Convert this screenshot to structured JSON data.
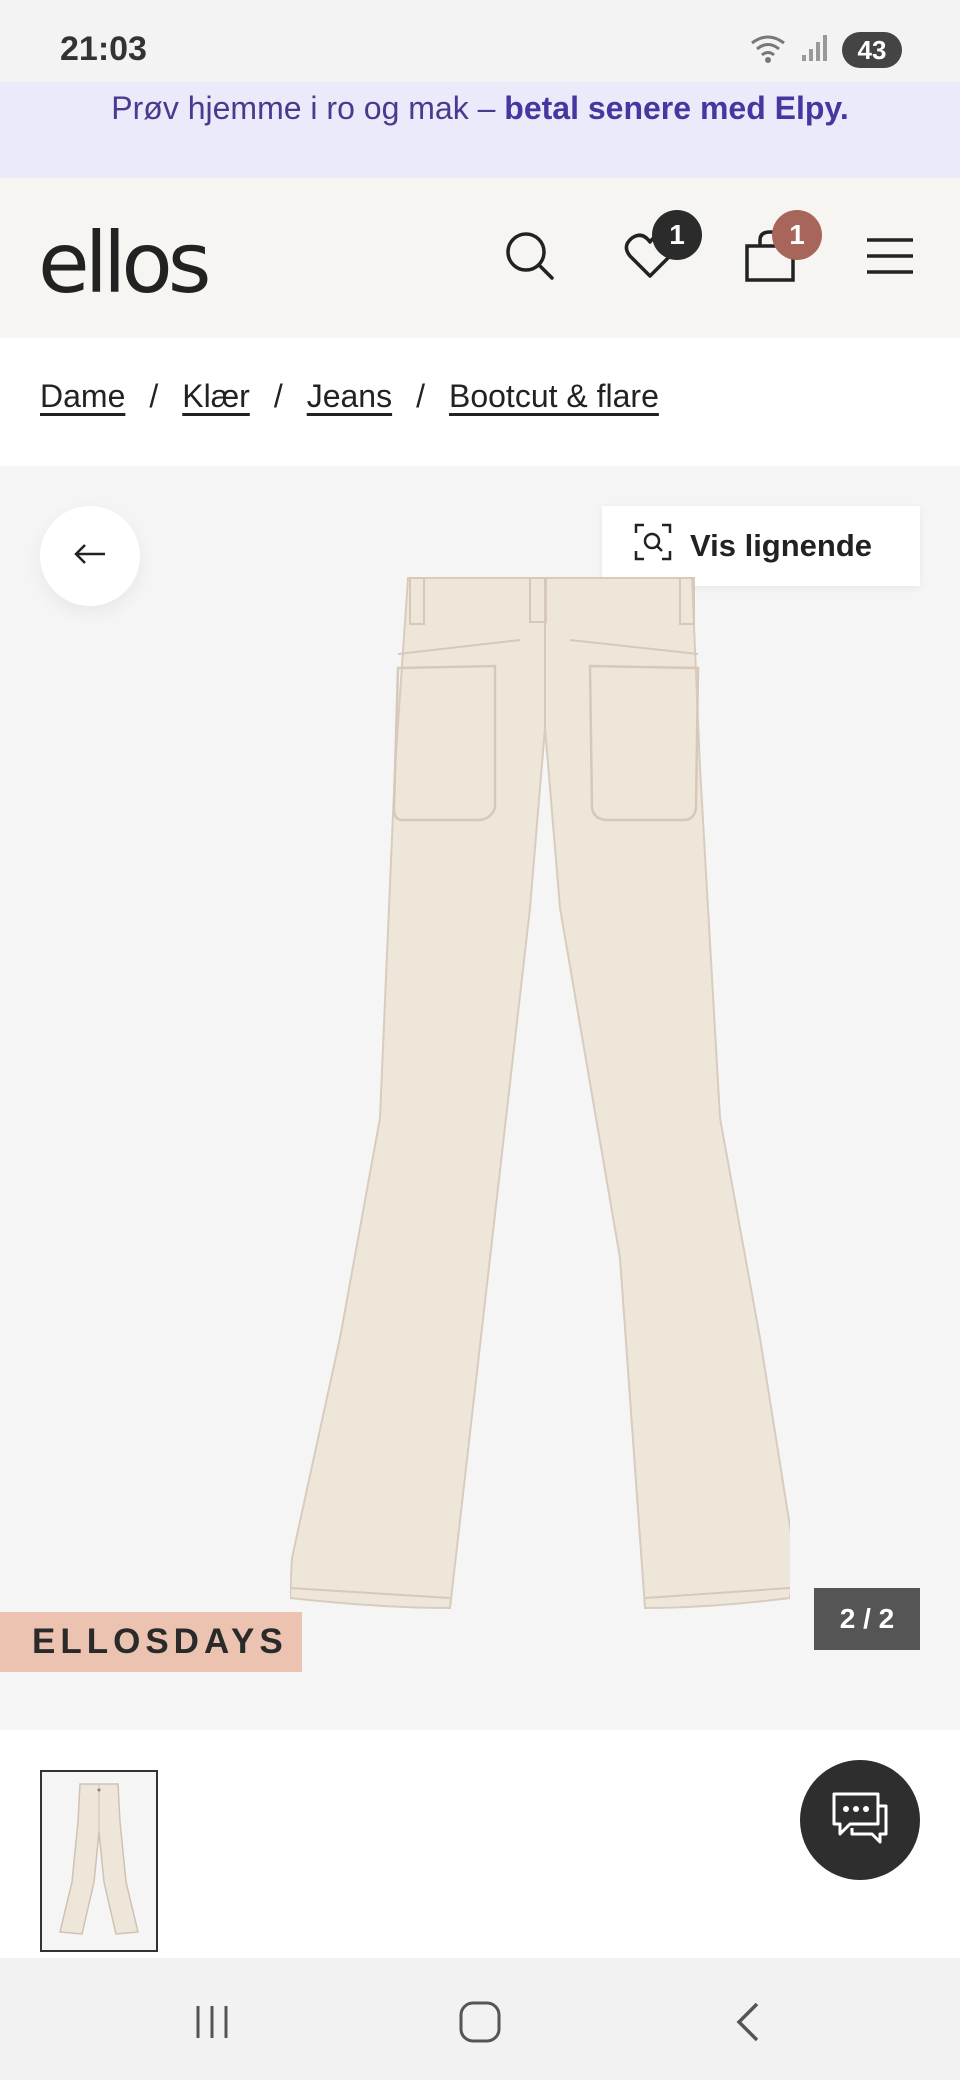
{
  "status_bar": {
    "time": "21:03",
    "battery": "43"
  },
  "promo": {
    "text": "Prøv hjemme i ro og mak – ",
    "highlight": "betal senere med Elpy."
  },
  "header": {
    "logo": "ellos",
    "wishlist_count": "1",
    "cart_count": "1",
    "icons": [
      "search-icon",
      "heart-icon",
      "shopping-bag-icon",
      "menu-icon"
    ]
  },
  "breadcrumb": {
    "items": [
      "Dame",
      "Klær",
      "Jeans",
      "Bootcut & flare"
    ],
    "separator": "/"
  },
  "gallery": {
    "similar_label": "Vis lignende",
    "campaign_label": "ELLOSDAYS",
    "counter": "2 / 2",
    "product_color": "#efe6da"
  },
  "colors": {
    "promo_bg": "#ebeafb",
    "promo_text": "#4636a0",
    "header_bg": "#f6f5f2",
    "wishlist_badge": "#2b2b2b",
    "cart_badge": "#a8655a",
    "campaign_bg": "#ecc3b0"
  }
}
